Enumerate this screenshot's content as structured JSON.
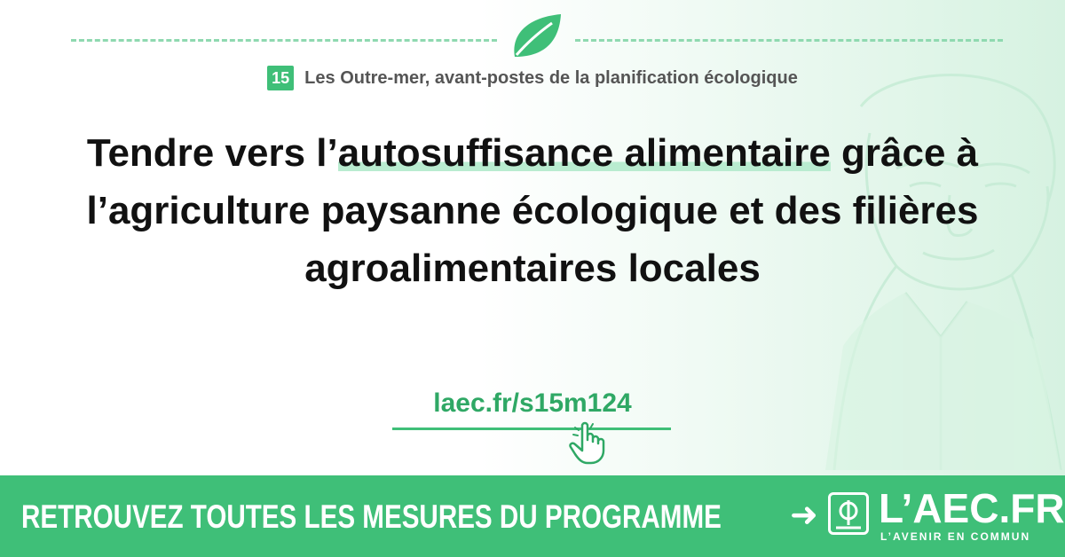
{
  "header": {
    "badge": "15",
    "subtitle": "Les Outre-mer, avant-postes de la planification écologique"
  },
  "headline": {
    "part1": "Tendre vers l’",
    "highlight": "autosuffisance alimentaire",
    "part2": "grâce à l’agriculture paysanne écologique et des filières agroalimentaires locales"
  },
  "link": {
    "text": "laec.fr/s15m124"
  },
  "banner": {
    "text": "RETROUVEZ TOUTES LES MESURES DU PROGRAMME",
    "arrow": "➜",
    "logo_name": "L’AEC.FR",
    "logo_tagline": "L’AVENIR EN COMMUN"
  },
  "icons": [
    "leaf-icon",
    "pointing-hand-icon",
    "phi-logo-icon"
  ],
  "colors": {
    "accent": "#3fbf78",
    "highlight": "#b9ecd0",
    "text": "#111111",
    "subtitle": "#555555"
  }
}
